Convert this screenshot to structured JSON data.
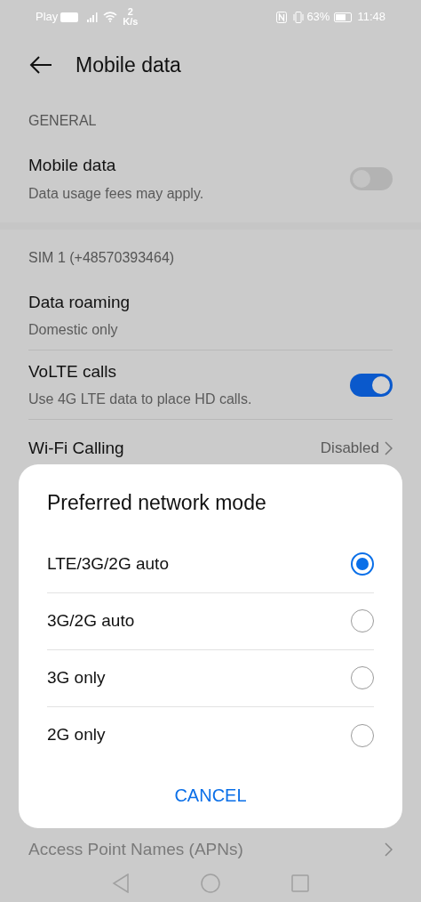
{
  "status_bar": {
    "carrier": "Play",
    "speed_value": "2",
    "speed_unit": "K/s",
    "battery_percent": "63%",
    "time": "11:48"
  },
  "header": {
    "title": "Mobile data"
  },
  "sections": [
    {
      "heading": "GENERAL",
      "items": [
        {
          "kind": "switch",
          "title": "Mobile data",
          "subtitle": "Data usage fees may apply.",
          "on": false
        }
      ]
    },
    {
      "heading": "SIM 1 (+48570393464)",
      "items": [
        {
          "kind": "plain",
          "title": "Data roaming",
          "subtitle": "Domestic only"
        },
        {
          "kind": "switch",
          "title": "VoLTE calls",
          "subtitle": "Use 4G LTE data to place HD calls.",
          "on": true
        },
        {
          "kind": "link",
          "title": "Wi-Fi Calling",
          "value": "Disabled"
        }
      ]
    }
  ],
  "bottom_item": {
    "title": "Access Point Names (APNs)"
  },
  "dialog": {
    "title": "Preferred network mode",
    "options": [
      {
        "label": "LTE/3G/2G auto",
        "selected": true
      },
      {
        "label": "3G/2G auto",
        "selected": false
      },
      {
        "label": "3G only",
        "selected": false
      },
      {
        "label": "2G only",
        "selected": false
      }
    ],
    "cancel": "CANCEL"
  }
}
